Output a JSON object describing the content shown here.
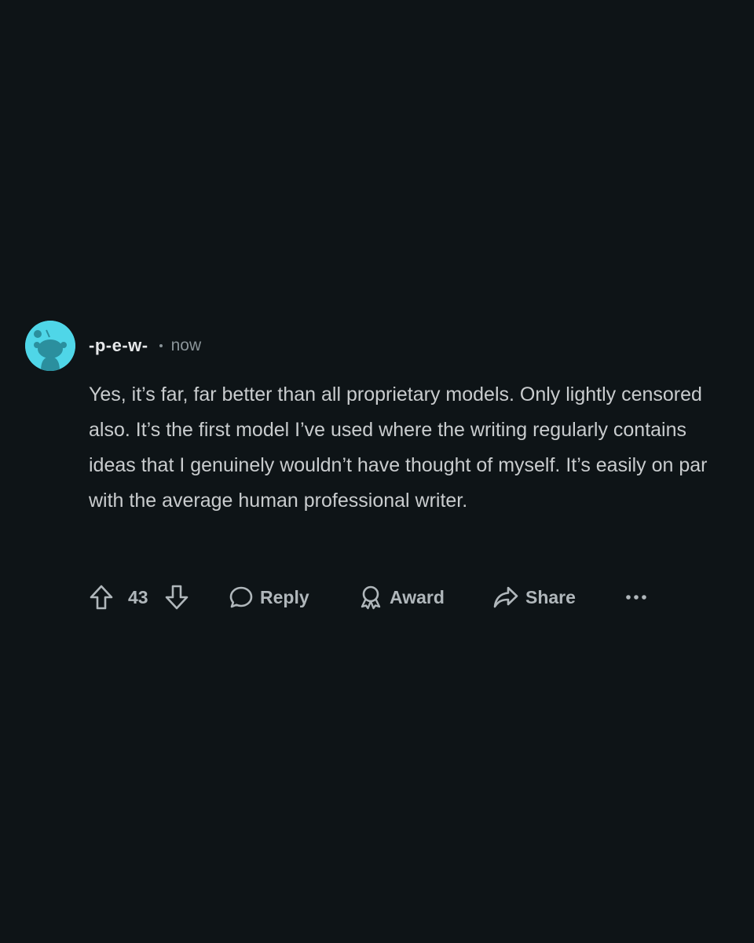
{
  "comment": {
    "username": "-p-e-w-",
    "timestamp": "now",
    "body": "Yes, it’s far, far better than all proprietary models. Only lightly censored also. It’s the first model I’ve used where the writing regularly contains ideas that I genuinely wouldn’t have thought of myself. It’s easily on par with the average human professional writer.",
    "avatar_icon": "reddit-snoo-avatar",
    "avatar_color": "#4fd6e8"
  },
  "actions": {
    "upvote_icon": "arrow-up-icon",
    "vote_count": "43",
    "downvote_icon": "arrow-down-icon",
    "reply_label": "Reply",
    "award_label": "Award",
    "share_label": "Share",
    "more_icon": "ellipsis-icon"
  },
  "colors": {
    "background": "#0e1417",
    "text": "#c9ccce",
    "muted": "#8a9499",
    "action": "#b0b7bb"
  }
}
